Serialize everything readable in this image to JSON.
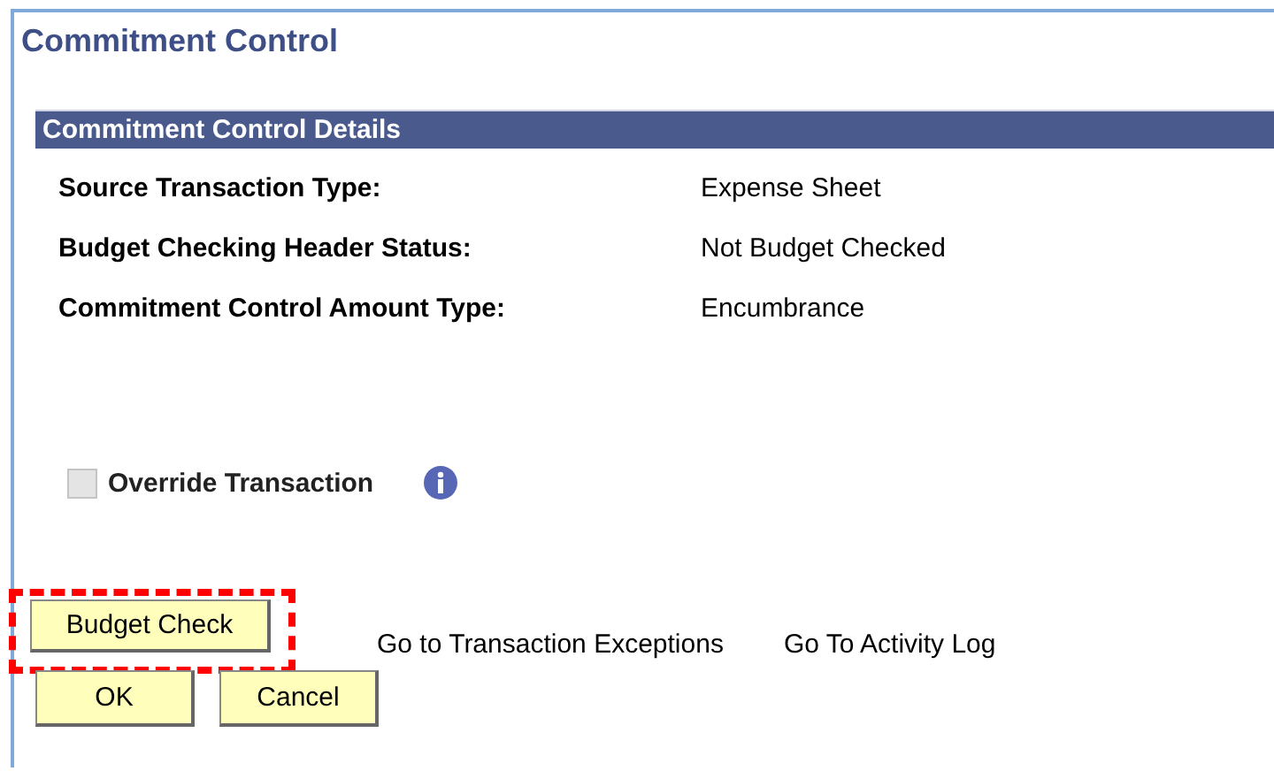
{
  "page": {
    "title": "Commitment Control"
  },
  "section": {
    "title": "Commitment Control Details"
  },
  "fields": [
    {
      "label": "Source Transaction Type:",
      "value": "Expense Sheet"
    },
    {
      "label": "Budget Checking Header Status:",
      "value": "Not Budget Checked"
    },
    {
      "label": "Commitment Control Amount Type:",
      "value": "Encumbrance"
    }
  ],
  "override": {
    "label": "Override Transaction",
    "checked": false,
    "disabled": true
  },
  "action_button": {
    "label": "Budget Check",
    "highlighted": true
  },
  "links": [
    "Go to Transaction Exceptions",
    "Go To Activity Log"
  ],
  "footer_buttons": [
    "OK",
    "Cancel"
  ]
}
